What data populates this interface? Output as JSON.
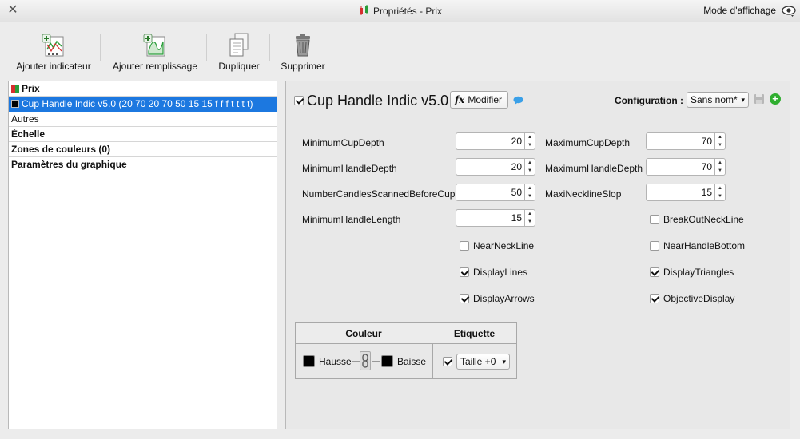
{
  "window": {
    "title": "Propriétés - Prix",
    "display_mode_label": "Mode d'affichage",
    "close_glyph": "✕"
  },
  "toolbar": {
    "add_indicator": "Ajouter indicateur",
    "add_fill": "Ajouter remplissage",
    "duplicate": "Dupliquer",
    "delete": "Supprimer"
  },
  "tree": {
    "items": [
      {
        "label": "Prix",
        "bold": true,
        "swatch": "prix"
      },
      {
        "label": "Cup Handle Indic v5.0 (20 70 20 70 50 15 15 f f f t t t t)",
        "selected": true,
        "swatch": "cup"
      },
      {
        "label": "Autres"
      },
      {
        "label": "Échelle",
        "bold": true
      },
      {
        "label": "Zones de couleurs (0)",
        "bold": true
      },
      {
        "label": "Paramètres du graphique",
        "bold": true
      }
    ]
  },
  "indicator": {
    "title": "Cup Handle Indic v5.0",
    "enabled": true,
    "modify_button": "Modifier",
    "fx_glyph": "fx",
    "configuration_label": "Configuration :",
    "configuration_value": "Sans nom*"
  },
  "params": {
    "min_cup_depth": {
      "label": "MinimumCupDepth",
      "value": "20"
    },
    "max_cup_depth": {
      "label": "MaximumCupDepth",
      "value": "70"
    },
    "min_handle_depth": {
      "label": "MinimumHandleDepth",
      "value": "20"
    },
    "max_handle_depth": {
      "label": "MaximumHandleDepth",
      "value": "70"
    },
    "candles_scanned": {
      "label": "NumberCandlesScannedBeforeCup",
      "value": "50"
    },
    "maxi_neckline_slop": {
      "label": "MaxiNecklineSlop",
      "value": "15"
    },
    "min_handle_length": {
      "label": "MinimumHandleLength",
      "value": "15"
    }
  },
  "checkboxes": {
    "breakout_neckline": {
      "label": "BreakOutNeckLine",
      "checked": false
    },
    "near_neckline": {
      "label": "NearNeckLine",
      "checked": false
    },
    "near_handle_bottom": {
      "label": "NearHandleBottom",
      "checked": false
    },
    "display_lines": {
      "label": "DisplayLines",
      "checked": true
    },
    "display_triangles": {
      "label": "DisplayTriangles",
      "checked": true
    },
    "display_arrows": {
      "label": "DisplayArrows",
      "checked": true
    },
    "objective_display": {
      "label": "ObjectiveDisplay",
      "checked": true
    }
  },
  "color_table": {
    "color_header": "Couleur",
    "label_header": "Etiquette",
    "up_label": "Hausse",
    "down_label": "Baisse",
    "up_color": "#000000",
    "down_color": "#000000",
    "label_enabled": true,
    "size_value": "Taille +0"
  }
}
